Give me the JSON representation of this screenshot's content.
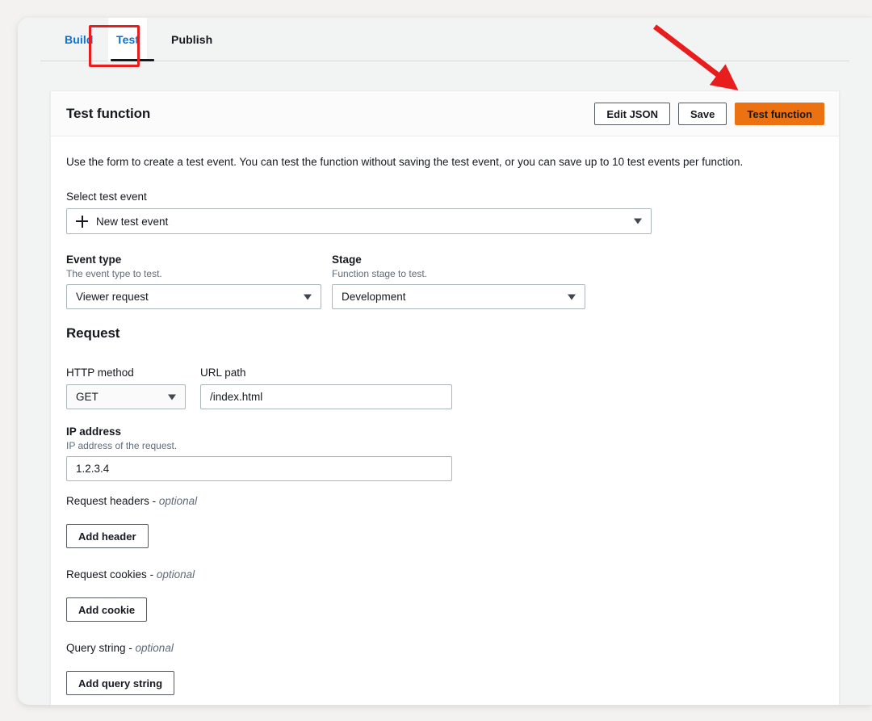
{
  "tabs": [
    {
      "label": "Build",
      "selected": false
    },
    {
      "label": "Test",
      "selected": true
    },
    {
      "label": "Publish",
      "selected": false
    }
  ],
  "panel": {
    "title": "Test function",
    "actions": {
      "edit_json": "Edit JSON",
      "save": "Save",
      "test_function": "Test function"
    },
    "intro": "Use the form to create a test event. You can test the function without saving the test event, or you can save up to 10 test events per function."
  },
  "form": {
    "select_test_event": {
      "label": "Select test event",
      "value": "New test event",
      "icon": "plus-icon",
      "caret": "chevron-down-icon"
    },
    "event_type": {
      "label": "Event type",
      "description": "The event type to test.",
      "value": "Viewer request"
    },
    "stage": {
      "label": "Stage",
      "description": "Function stage to test.",
      "value": "Development"
    }
  },
  "request": {
    "heading": "Request",
    "http_method": {
      "label": "HTTP method",
      "value": "GET"
    },
    "url_path": {
      "label": "URL path",
      "value": "/index.html",
      "placeholder": "/index.html"
    },
    "ip_address": {
      "label": "IP address",
      "description": "IP address of the request.",
      "value": "1.2.3.4",
      "placeholder": "1.2.3.4"
    },
    "headers": {
      "label": "Request headers",
      "optional": "optional",
      "button": "Add header"
    },
    "cookies": {
      "label": "Request cookies",
      "optional": "optional",
      "button": "Add cookie"
    },
    "query_string": {
      "label": "Query string",
      "optional": "optional",
      "button": "Add query string"
    }
  },
  "annotations": {
    "highlight_color": "#e81d1d",
    "arrow_color": "#e81d1d",
    "highlight_target": "Test",
    "arrow_target": "Test function"
  },
  "colors": {
    "accent_orange": "#ec7211",
    "link_blue": "#0972d3",
    "text_dark": "#16191f",
    "text_muted": "#5f6b7a",
    "border": "#aab7b8",
    "page_bg": "#f4f2f0",
    "shell_bg": "#f2f3f3"
  }
}
